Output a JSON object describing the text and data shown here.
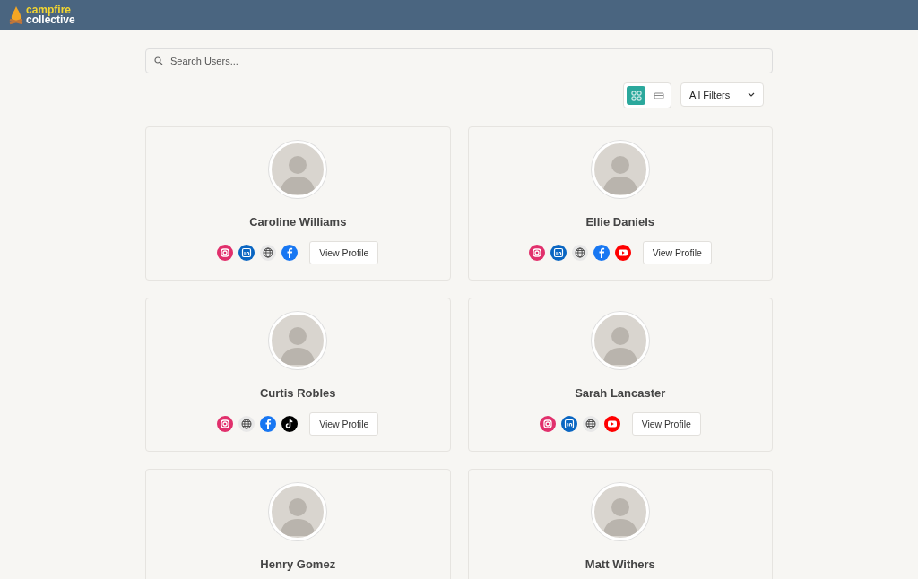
{
  "header": {
    "logo_top": "campfire",
    "logo_bottom": "collective"
  },
  "search": {
    "placeholder": "Search Users..."
  },
  "view_toggle": [
    {
      "kind": "grid",
      "selected": true
    },
    {
      "kind": "list",
      "selected": false
    }
  ],
  "filter": {
    "label": "All Filters"
  },
  "users": [
    {
      "name": "Caroline Williams",
      "socials": [
        {
          "kind": "instagram"
        },
        {
          "kind": "linkedin"
        },
        {
          "kind": "web"
        },
        {
          "kind": "facebook"
        }
      ],
      "button": "View Profile"
    },
    {
      "name": "Ellie Daniels",
      "socials": [
        {
          "kind": "instagram"
        },
        {
          "kind": "linkedin"
        },
        {
          "kind": "web"
        },
        {
          "kind": "facebook"
        },
        {
          "kind": "youtube"
        }
      ],
      "button": "View Profile"
    },
    {
      "name": "Curtis Robles",
      "socials": [
        {
          "kind": "instagram"
        },
        {
          "kind": "web"
        },
        {
          "kind": "facebook"
        },
        {
          "kind": "tiktok"
        }
      ],
      "button": "View Profile"
    },
    {
      "name": "Sarah Lancaster",
      "socials": [
        {
          "kind": "instagram"
        },
        {
          "kind": "linkedin"
        },
        {
          "kind": "web"
        },
        {
          "kind": "youtube"
        }
      ],
      "button": "View Profile"
    },
    {
      "name": "Henry Gomez"
    },
    {
      "name": "Matt Withers"
    }
  ]
}
